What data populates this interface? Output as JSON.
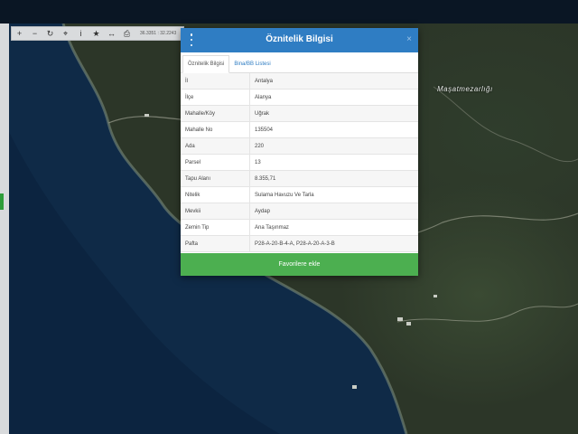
{
  "map": {
    "place_label": "Maşatmezarlığı"
  },
  "toolbar": {
    "buttons": [
      {
        "name": "zoom-in",
        "glyph": "+"
      },
      {
        "name": "zoom-out",
        "glyph": "−"
      },
      {
        "name": "refresh",
        "glyph": "↻"
      },
      {
        "name": "locate",
        "glyph": "⌖"
      },
      {
        "name": "info",
        "glyph": "i"
      },
      {
        "name": "favorite",
        "glyph": "★"
      },
      {
        "name": "measure",
        "glyph": "↔"
      },
      {
        "name": "print",
        "glyph": "⎙"
      }
    ],
    "coords": "36.3351 : 32.2243"
  },
  "dialog": {
    "title": "Öznitelik Bilgisi",
    "close_glyph": "×",
    "tabs": [
      {
        "label": "Öznitelik Bilgisi",
        "active": true
      },
      {
        "label": "Bina/BB Listesi",
        "active": false
      }
    ],
    "rows": [
      {
        "key": "İl",
        "value": "Antalya"
      },
      {
        "key": "İlçe",
        "value": "Alanya"
      },
      {
        "key": "Mahalle/Köy",
        "value": "Uğrak"
      },
      {
        "key": "Mahalle No",
        "value": "135504"
      },
      {
        "key": "Ada",
        "value": "220"
      },
      {
        "key": "Parsel",
        "value": "13"
      },
      {
        "key": "Tapu Alanı",
        "value": "8.355,71"
      },
      {
        "key": "Nitelik",
        "value": "Sulama Havuzu Ve Tarla"
      },
      {
        "key": "Mevkii",
        "value": "Aydap"
      },
      {
        "key": "Zemin Tip",
        "value": "Ana Taşınmaz"
      },
      {
        "key": "Pafta",
        "value": "P28-A-20-B-4-A, P28-A-20-A-3-B"
      }
    ],
    "favorite_button": "Favorilere ekle"
  },
  "colors": {
    "header_blue": "#2f7dc3",
    "favorite_green": "#4caf50"
  }
}
